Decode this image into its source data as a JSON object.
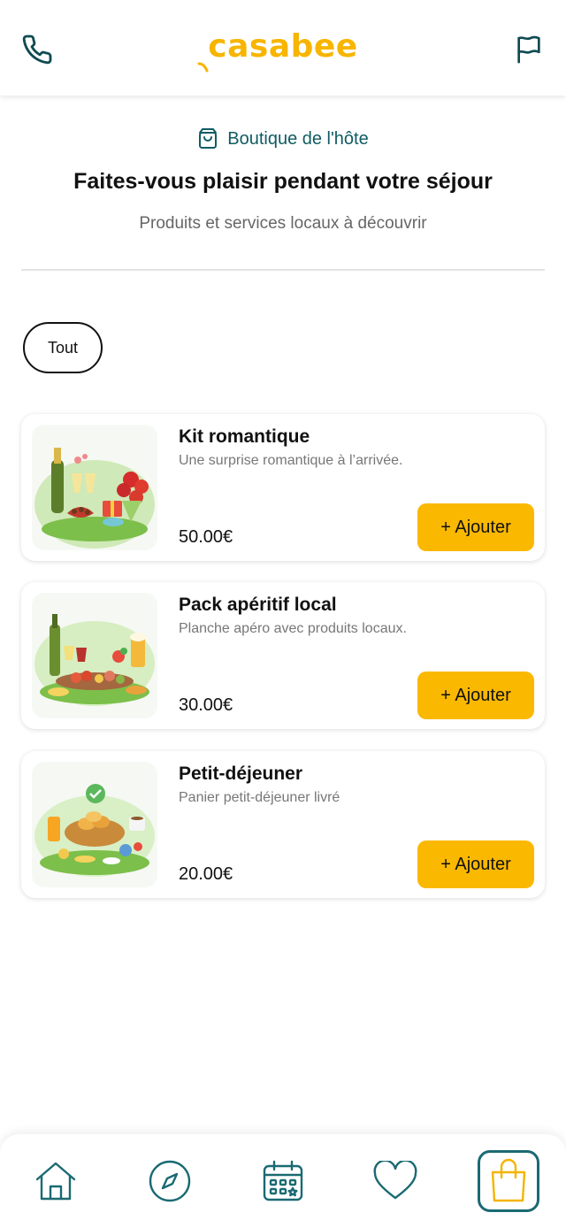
{
  "header": {
    "logo_text": "casabee",
    "phone_icon": "phone-icon",
    "flag_icon": "flag-icon"
  },
  "intro": {
    "shop_label": "Boutique de l'hôte",
    "title": "Faites-vous plaisir pendant votre séjour",
    "subtitle": "Produits et services locaux à découvrir"
  },
  "filters": [
    {
      "label": "Tout",
      "selected": true
    }
  ],
  "products": [
    {
      "name": "Kit romantique",
      "description": "Une surprise romantique à l’arrivée.",
      "price": "50.00€",
      "button": "+ Ajouter",
      "image": "romantic-kit-illustration"
    },
    {
      "name": "Pack apéritif local",
      "description": "Planche apéro avec produits locaux.",
      "price": "30.00€",
      "button": "+ Ajouter",
      "image": "aperitif-pack-illustration"
    },
    {
      "name": "Petit-déjeuner",
      "description": "Panier petit-déjeuner livré",
      "price": "20.00€",
      "button": "+ Ajouter",
      "image": "breakfast-illustration"
    }
  ],
  "bottom_nav": [
    {
      "icon": "home-icon",
      "active": false
    },
    {
      "icon": "compass-icon",
      "active": false
    },
    {
      "icon": "calendar-icon",
      "active": false
    },
    {
      "icon": "heart-icon",
      "active": false
    },
    {
      "icon": "shopping-bag-icon",
      "active": true
    }
  ],
  "colors": {
    "brand": "#f7b500",
    "accent": "#0f5c63",
    "button": "#fbb800",
    "nav_active_border": "#1a6a72"
  }
}
